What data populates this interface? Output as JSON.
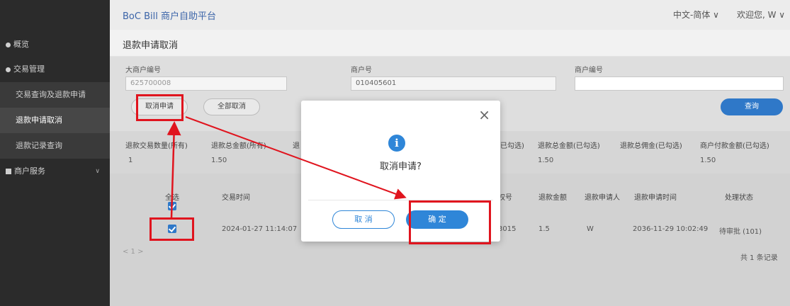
{
  "header": {
    "app_title": "BoC Bill 商户自助平台",
    "language": "中文-简体 ∨",
    "welcome": "欢迎您, W ∨"
  },
  "sidebar": {
    "items": [
      {
        "label": "概览"
      },
      {
        "label": "交易管理"
      },
      {
        "label": "交易查询及退款申请"
      },
      {
        "label": "退款申请取消"
      },
      {
        "label": "退款记录查询"
      },
      {
        "label": "商户服务"
      }
    ]
  },
  "page": {
    "title": "退款申请取消"
  },
  "filters": {
    "big_merchant_label": "大商户编号",
    "big_merchant_value": "625700008",
    "merchant_no_label": "商户号",
    "merchant_no_value": "010405601",
    "merchant_code_label": "商户编号",
    "merchant_code_value": ""
  },
  "actions": {
    "cancel_apply": "取消申请",
    "cancel_all": "全部取消",
    "search": "查询"
  },
  "stats": {
    "headers": [
      "退款交易数量(所有)",
      "退款总金额(所有)",
      "退",
      "退款总金额(已勾选)",
      "退款总佣金(已勾选)",
      "商户付款金额(已勾选)"
    ],
    "partial_header": "已勾选)",
    "values": [
      "1",
      "1.50",
      "1.50",
      "1.50"
    ]
  },
  "table": {
    "headers": {
      "select": "全选",
      "trade_time": "交易时间",
      "order_no": "权号",
      "refund_amount": "退款金额",
      "applicant": "退款申请人",
      "apply_time": "退款申请时间",
      "status": "处理状态"
    },
    "row": {
      "trade_time": "2024-01-27 11:14:07",
      "order_no": "3015",
      "refund_amount": "1.5",
      "applicant": "W",
      "apply_time": "2036-11-29 10:02:49",
      "status": "待审批 (101)"
    },
    "pager": "< 1 >",
    "total": "共 1 条记录"
  },
  "modal": {
    "close": "×",
    "icon": "info-icon",
    "message": "取消申请?",
    "cancel": "取 消",
    "confirm": "确 定"
  },
  "colors": {
    "accent": "#2f86d8",
    "annotation_red": "#e0141e",
    "sidebar": "#2b2b2b"
  }
}
